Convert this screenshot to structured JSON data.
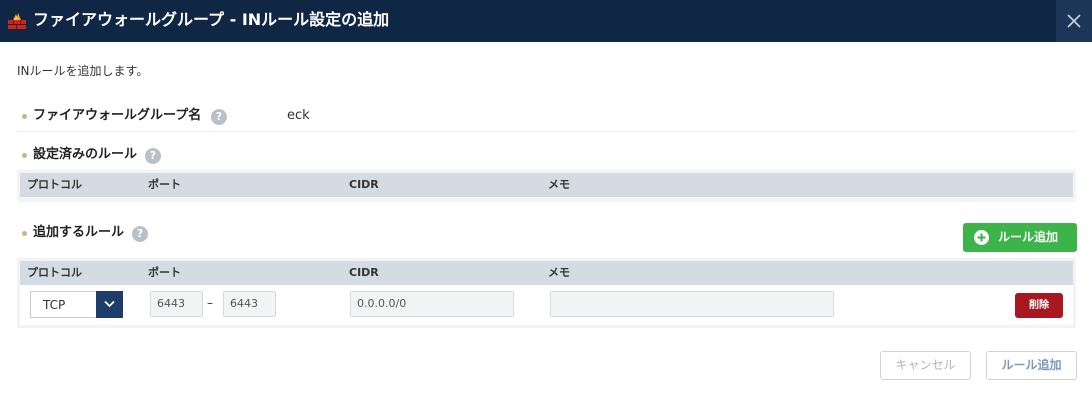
{
  "dialog": {
    "title": "ファイアウォールグループ - INルール設定の追加",
    "intro": "INルールを追加します。"
  },
  "firewall_group": {
    "label": "ファイアウォールグループ名",
    "value": "eck",
    "help": "?"
  },
  "existing_rules": {
    "label": "設定済みのルール",
    "help": "?",
    "columns": [
      "プロトコル",
      "ポート",
      "CIDR",
      "メモ"
    ]
  },
  "new_rules": {
    "label": "追加するルール",
    "help": "?",
    "add_button": "ルール追加",
    "columns": [
      "プロトコル",
      "ポート",
      "CIDR",
      "メモ"
    ],
    "rows": [
      {
        "protocol": "TCP",
        "port_from": "6443",
        "port_to": "6443",
        "separator": "–",
        "cidr": "0.0.0.0/0",
        "memo": "",
        "delete_label": "削除"
      }
    ]
  },
  "footer": {
    "cancel_label": "キャンセル",
    "submit_label": "ルール追加"
  },
  "colors": {
    "titlebar": "#102645",
    "add_button": "#3cb44a",
    "delete_button": "#a8191f",
    "select_button": "#1f3d6b",
    "table_header": "#d5dbe3"
  }
}
